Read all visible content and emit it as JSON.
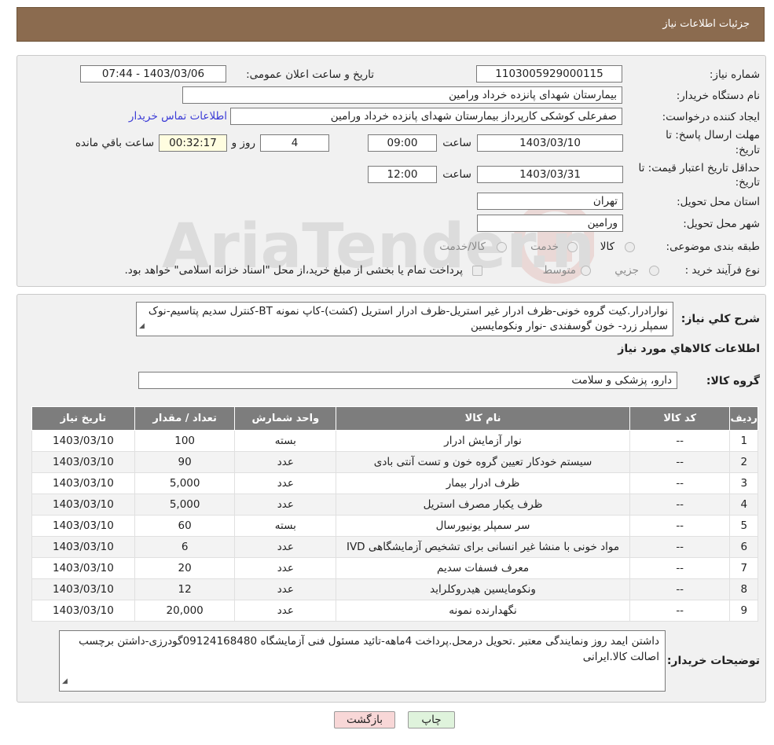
{
  "header": {
    "title": "جزئیات اطلاعات نیاز"
  },
  "info": {
    "need_number_label": "شماره نیاز:",
    "need_number": "1103005929000115",
    "announce_label": "تاریخ و ساعت اعلان عمومی:",
    "announce_value": "1403/03/06 - 07:44",
    "buyer_org_label": "نام دستگاه خریدار:",
    "buyer_org": "بیمارستان شهدای پانزده خرداد ورامین",
    "creator_label": "ایجاد کننده درخواست:",
    "creator": "صفرعلی کوشکی کارپرداز بیمارستان شهدای پانزده خرداد ورامین",
    "contact_link": "اطلاعات تماس خریدار",
    "deadline_label_1": "مهلت ارسال پاسخ: تا",
    "deadline_label_2": "تاریخ:",
    "deadline_date": "1403/03/10",
    "time_word": "ساعت",
    "deadline_time": "09:00",
    "days_value": "4",
    "days_word": "روز و",
    "remaining_time": "00:32:17",
    "remaining_word": "ساعت باقي مانده",
    "validity_label_1": "حداقل تاریخ اعتبار قیمت: تا",
    "validity_label_2": "تاریخ:",
    "validity_date": "1403/03/31",
    "validity_time": "12:00",
    "province_label": "استان محل تحویل:",
    "province": "تهران",
    "city_label": "شهر محل تحویل:",
    "city": "ورامین",
    "category_label": "طبقه بندی موضوعی:",
    "category_options": [
      "کالا",
      "خدمت",
      "کالا/خدمت"
    ],
    "process_label": "نوع فرآیند خرید :",
    "process_options": [
      "جزيي",
      "متوسط"
    ],
    "process_note": "پرداخت تمام یا بخشی از مبلغ خرید،از محل \"اسناد خزانه اسلامی\" خواهد بود."
  },
  "description": {
    "label": "شرح کلي نياز:",
    "text": "نوارادرار.کیت گروه خونی-ظرف ادرار غیر استریل-ظرف ادرار استریل (کشت)-کاپ نمونه BT-کنترل سدیم پتاسیم-نوک سمپلر زرد- خون گوسفندی -نوار ونکومایسین"
  },
  "goods": {
    "section_title": "اطلاعات کالاهاي مورد نياز",
    "group_label": "گروه کالا:",
    "group_value": "دارو، پزشکی و سلامت",
    "columns": [
      "ردیف",
      "کد کالا",
      "نام کالا",
      "واحد شمارش",
      "تعداد / مقدار",
      "تاریخ نیاز"
    ],
    "rows": [
      [
        "1",
        "--",
        "نوار آزمایش ادرار",
        "بسته",
        "100",
        "1403/03/10"
      ],
      [
        "2",
        "--",
        "سیستم خودکار تعیین گروه خون و تست آنتی بادی",
        "عدد",
        "90",
        "1403/03/10"
      ],
      [
        "3",
        "--",
        "ظرف ادرار بیمار",
        "عدد",
        "5,000",
        "1403/03/10"
      ],
      [
        "4",
        "--",
        "ظرف یکبار مصرف استریل",
        "عدد",
        "5,000",
        "1403/03/10"
      ],
      [
        "5",
        "--",
        "سر سمپلر یونیورسال",
        "بسته",
        "60",
        "1403/03/10"
      ],
      [
        "6",
        "--",
        "مواد خونی با منشا غیر انسانی برای تشخیص آزمایشگاهی IVD",
        "عدد",
        "6",
        "1403/03/10"
      ],
      [
        "7",
        "--",
        "معرف فسفات سدیم",
        "عدد",
        "20",
        "1403/03/10"
      ],
      [
        "8",
        "--",
        "ونکومایسین هیدروکلراید",
        "عدد",
        "12",
        "1403/03/10"
      ],
      [
        "9",
        "--",
        "نگهدارنده نمونه",
        "عدد",
        "20,000",
        "1403/03/10"
      ]
    ]
  },
  "buyer_notes": {
    "label": "توضیحات خریدار:",
    "text": "داشتن ایمد روز ونمایندگی معتبر .تحویل درمحل.پرداخت 4ماهه-تائید مسئول فنی آزمایشگاه 09124168480گودرزی-داشتن برچسب اصالت کالا.ایرانی"
  },
  "buttons": {
    "print": "چاپ",
    "back": "بازگشت"
  },
  "watermark": {
    "text": "AriaTender.neT"
  },
  "colors": {
    "header_bg": "#8b6b4f",
    "link": "#3b3bd6",
    "table_header": "#7d7d7d",
    "back_button": "#f8d7d7",
    "print_button": "#dff3dc"
  }
}
